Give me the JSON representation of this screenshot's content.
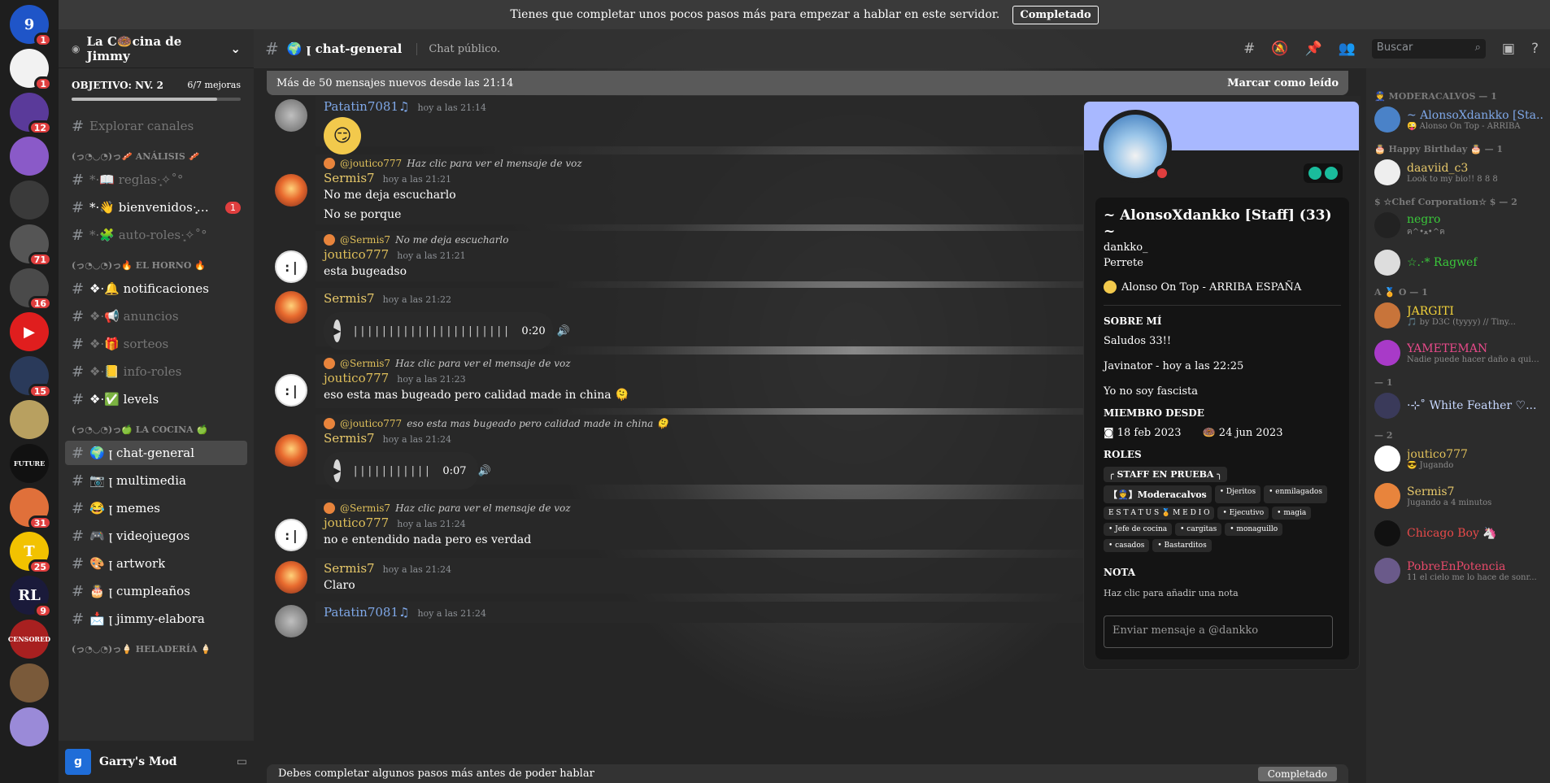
{
  "notice": {
    "text": "Tienes que completar unos pocos pasos más para empezar a hablar en este servidor.",
    "button": "Completado"
  },
  "servers": [
    {
      "icon": "server-icon-blue",
      "label": "9",
      "color": "#1f55c8",
      "badge": "1"
    },
    {
      "icon": "server-icon-jimmy",
      "label": "",
      "color": "#f2f2f2",
      "badge": "1"
    },
    {
      "icon": "server-icon-purple",
      "label": "",
      "color": "#5a3a9a",
      "badge": "12"
    },
    {
      "icon": "server-icon-anime",
      "label": "",
      "color": "#8a5ac8",
      "badge": ""
    },
    {
      "icon": "server-icon-dark",
      "label": "",
      "color": "#3a3a3a",
      "badge": ""
    },
    {
      "icon": "server-icon-face",
      "label": "",
      "color": "#555555",
      "badge": "71"
    },
    {
      "icon": "server-icon-gray",
      "label": "",
      "color": "#4a4a4a",
      "badge": "16"
    },
    {
      "icon": "youtube-icon",
      "label": "▶",
      "color": "#e01e1e",
      "badge": ""
    },
    {
      "icon": "server-icon-r",
      "label": "",
      "color": "#2a3a5a",
      "badge": "15"
    },
    {
      "icon": "server-icon-cat",
      "label": "",
      "color": "#b8a060",
      "badge": ""
    },
    {
      "icon": "future-icon",
      "label": "FUTURE",
      "color": "#111111",
      "badge": ""
    },
    {
      "icon": "server-icon-orange",
      "label": "",
      "color": "#e0703a",
      "badge": "31"
    },
    {
      "icon": "server-icon-t",
      "label": "T",
      "color": "#f2c200",
      "badge": "25"
    },
    {
      "icon": "rocket-league-icon",
      "label": "RL",
      "color": "#1a1a3a",
      "badge": "9"
    },
    {
      "icon": "censored-icon",
      "label": "CENSORED",
      "color": "#a82020",
      "badge": ""
    },
    {
      "icon": "server-icon-man",
      "label": "",
      "color": "#7a5a3a",
      "badge": ""
    },
    {
      "icon": "server-icon-anime2",
      "label": "",
      "color": "#9a8ad8",
      "badge": ""
    }
  ],
  "guild": {
    "name": "La C🍩cina de Jimmy",
    "goal_label": "OBJETIVO: NV. 2",
    "goal_progress": "6/7 mejoras",
    "goal_fraction": 0.86,
    "explore": "Explorar canales"
  },
  "categories": {
    "analisis": "(っ◔◡◔)っ🥓 ANÁLISIS 🥓",
    "horno": "(っ◔◡◔)っ🔥 EL HORNO 🔥",
    "cocina": "(っ◔◡◔)っ🍏 LA COCINA 🍏",
    "heladeria": "(っ◔◡◔)っ🍦 HELADERÍA 🍦"
  },
  "channels_analisis": [
    {
      "name": "*·📖 reglas·̩͙✧˚°",
      "muted": true,
      "badge": ""
    },
    {
      "name": "*·👋 bienvenidos·̩͙✧˚°",
      "muted": false,
      "badge": "1"
    },
    {
      "name": "*·🧩 auto-roles·̩͙✧˚°",
      "muted": true,
      "badge": ""
    }
  ],
  "channels_horno": [
    {
      "name": "❖·🔔 notificaciones",
      "muted": false
    },
    {
      "name": "❖·📢 anuncios",
      "muted": true
    },
    {
      "name": "❖·🎁 sorteos",
      "muted": true
    },
    {
      "name": "❖·📒 info-roles",
      "muted": true
    },
    {
      "name": "❖·✅ levels",
      "muted": false
    }
  ],
  "channels_cocina": [
    {
      "name": "🌍 ꞁ chat-general",
      "active": true
    },
    {
      "name": "📷 ꞁ multimedia",
      "active": false
    },
    {
      "name": "😂 ꞁ memes",
      "active": false
    },
    {
      "name": "🎮 ꞁ videojuegos",
      "active": false
    },
    {
      "name": "🎨 ꞁ artwork",
      "active": false
    },
    {
      "name": "🎂 ꞁ cumpleaños",
      "active": false
    },
    {
      "name": "📩 ꞁ jimmy-elabora",
      "active": false
    }
  ],
  "user_panel": {
    "activity": "Garry's Mod"
  },
  "topbar": {
    "channel": "🌍 ꞁ chat-general",
    "topic": "Chat público.",
    "search_placeholder": "Buscar"
  },
  "new_banner": {
    "text": "Más de 50 mensajes nuevos desde las 21:14",
    "action": "Marcar como leído"
  },
  "messages": [
    {
      "author": "Patatin7081♫",
      "ts": "hoy a las 21:14",
      "text": "",
      "reply": "",
      "reply_user": "",
      "style": "pat",
      "avatar": "gray",
      "emoji": "😏",
      "audio": ""
    },
    {
      "author": "Sermis7",
      "ts": "hoy a las 21:21",
      "text": "No me deja escucharlo",
      "text2": "No se porque",
      "reply_user": "@joutico777",
      "reply": "Haz clic para ver el mensaje de voz",
      "style": "sermis",
      "avatar": "sunset"
    },
    {
      "author": "joutico777",
      "ts": "hoy a las 21:21",
      "text": "esta bugeadso",
      "reply_user": "@Sermis7",
      "reply": "No me deja escucharlo",
      "style": "jou",
      "avatar": "face"
    },
    {
      "author": "Sermis7",
      "ts": "hoy a las 21:22",
      "text": "",
      "style": "sermis",
      "avatar": "sunset",
      "audio": "0:20"
    },
    {
      "author": "joutico777",
      "ts": "hoy a las 21:23",
      "text": "eso esta mas bugeado pero calidad made in china 🫠",
      "reply_user": "@Sermis7",
      "reply": "Haz clic para ver el mensaje de voz",
      "style": "jou",
      "avatar": "face"
    },
    {
      "author": "Sermis7",
      "ts": "hoy a las 21:24",
      "text": "",
      "reply_user": "@joutico777",
      "reply": "eso esta mas bugeado pero calidad made in china 🫠",
      "style": "sermis",
      "avatar": "sunset",
      "audio": "0:07"
    },
    {
      "author": "joutico777",
      "ts": "hoy a las 21:24",
      "text": "no e entendido nada pero es verdad",
      "reply_user": "@Sermis7",
      "reply": "Haz clic para ver el mensaje de voz",
      "style": "jou",
      "avatar": "face"
    },
    {
      "author": "Sermis7",
      "ts": "hoy a las 21:24",
      "text": "Claro",
      "style": "sermis",
      "avatar": "sunset"
    },
    {
      "author": "Patatin7081♫",
      "ts": "hoy a las 21:24",
      "text": "",
      "style": "pat",
      "avatar": "gray"
    }
  ],
  "profile": {
    "display_name": "~ AlonsoXdankko [Staff] (33) ~",
    "username": "dankko_",
    "pronouns": "Perrete",
    "status": "Alonso On Top - ARRIBA ESPAÑA",
    "about_title": "SOBRE MÍ",
    "about_lines": [
      "Saludos 33!!",
      "Javinator - hoy a las 22:25",
      "Yo no soy fascista"
    ],
    "member_since_title": "MIEMBRO DESDE",
    "discord_since": "18 feb 2023",
    "server_since": "24 jun 2023",
    "roles_title": "ROLES",
    "roles": [
      "╭ STAFF EN PRUEBA ╮",
      "【👮】Moderacalvos",
      "• Djeritos",
      "• enmilagados",
      "E S T A T U S 🏅 M E D I O",
      "• Ejecutivo",
      "• magia",
      "• Jefe de cocina",
      "• cargitas",
      "• monaguillo",
      "• casados",
      "• Bastarditos"
    ],
    "note_title": "NOTA",
    "note_placeholder": "Haz clic para añadir una nota",
    "dm_placeholder": "Enviar mensaje a @dankko"
  },
  "member_list": {
    "cat1": "👮 MODERACALVOS — 1",
    "cat2": "🎂 Happy Birthday 🎂 — 1",
    "cat3": "$ ☆Chef Corporation☆ $ — 2",
    "cat4": "A 🏅 O — 1",
    "cat5": "— 1",
    "cat6": "— 2",
    "members": [
      {
        "name": "~ AlonsoXdankko [Sta...",
        "sub": "😜 Alonso On Top - ARRIBA",
        "color": "#7fa8e8",
        "avatar": "#4a82c8"
      },
      {
        "name": "daaviid_c3",
        "sub": "Look to my bio!! 8 8 8",
        "color": "#e8c96a",
        "avatar": "#eeeeee"
      },
      {
        "name": "negro",
        "sub": "ฅ^•ﻌ•^ฅ",
        "color": "#3ac83a",
        "avatar": "#222222"
      },
      {
        "name": "☆.·* Ragwef",
        "sub": "",
        "color": "#3ac83a",
        "avatar": "#dddddd"
      },
      {
        "name": "JARGITI",
        "sub": "🎵 by D3C (tyyyy) // Tiny...",
        "color": "#f2d23a",
        "avatar": "#c8743a"
      },
      {
        "name": "YAMETEMAN",
        "sub": "Nadie puede hacer daño a quien...",
        "color": "#e84a8a",
        "avatar": "#a83ac8"
      },
      {
        "name": "·⊹˚ White Feather ♡...",
        "sub": "",
        "color": "#c8d8ff",
        "avatar": "#3a3a5a"
      },
      {
        "name": "joutico777",
        "sub": "😎 Jugando",
        "color": "#e0c05a",
        "avatar": "#ffffff"
      },
      {
        "name": "Sermis7",
        "sub": "Jugando a 4 minutos",
        "color": "#e8c96a",
        "avatar": "#e8843c"
      },
      {
        "name": "Chicago Boy 🦄",
        "sub": "",
        "color": "#e84a4a",
        "avatar": "#111111"
      },
      {
        "name": "PobreEnPotencia",
        "sub": "11 el cielo me lo hace de sonr...",
        "color": "#e84a6a",
        "avatar": "#6a5a8a"
      }
    ]
  },
  "bottom": {
    "text": "Debes completar algunos pasos más antes de poder hablar",
    "button": "Completado"
  }
}
